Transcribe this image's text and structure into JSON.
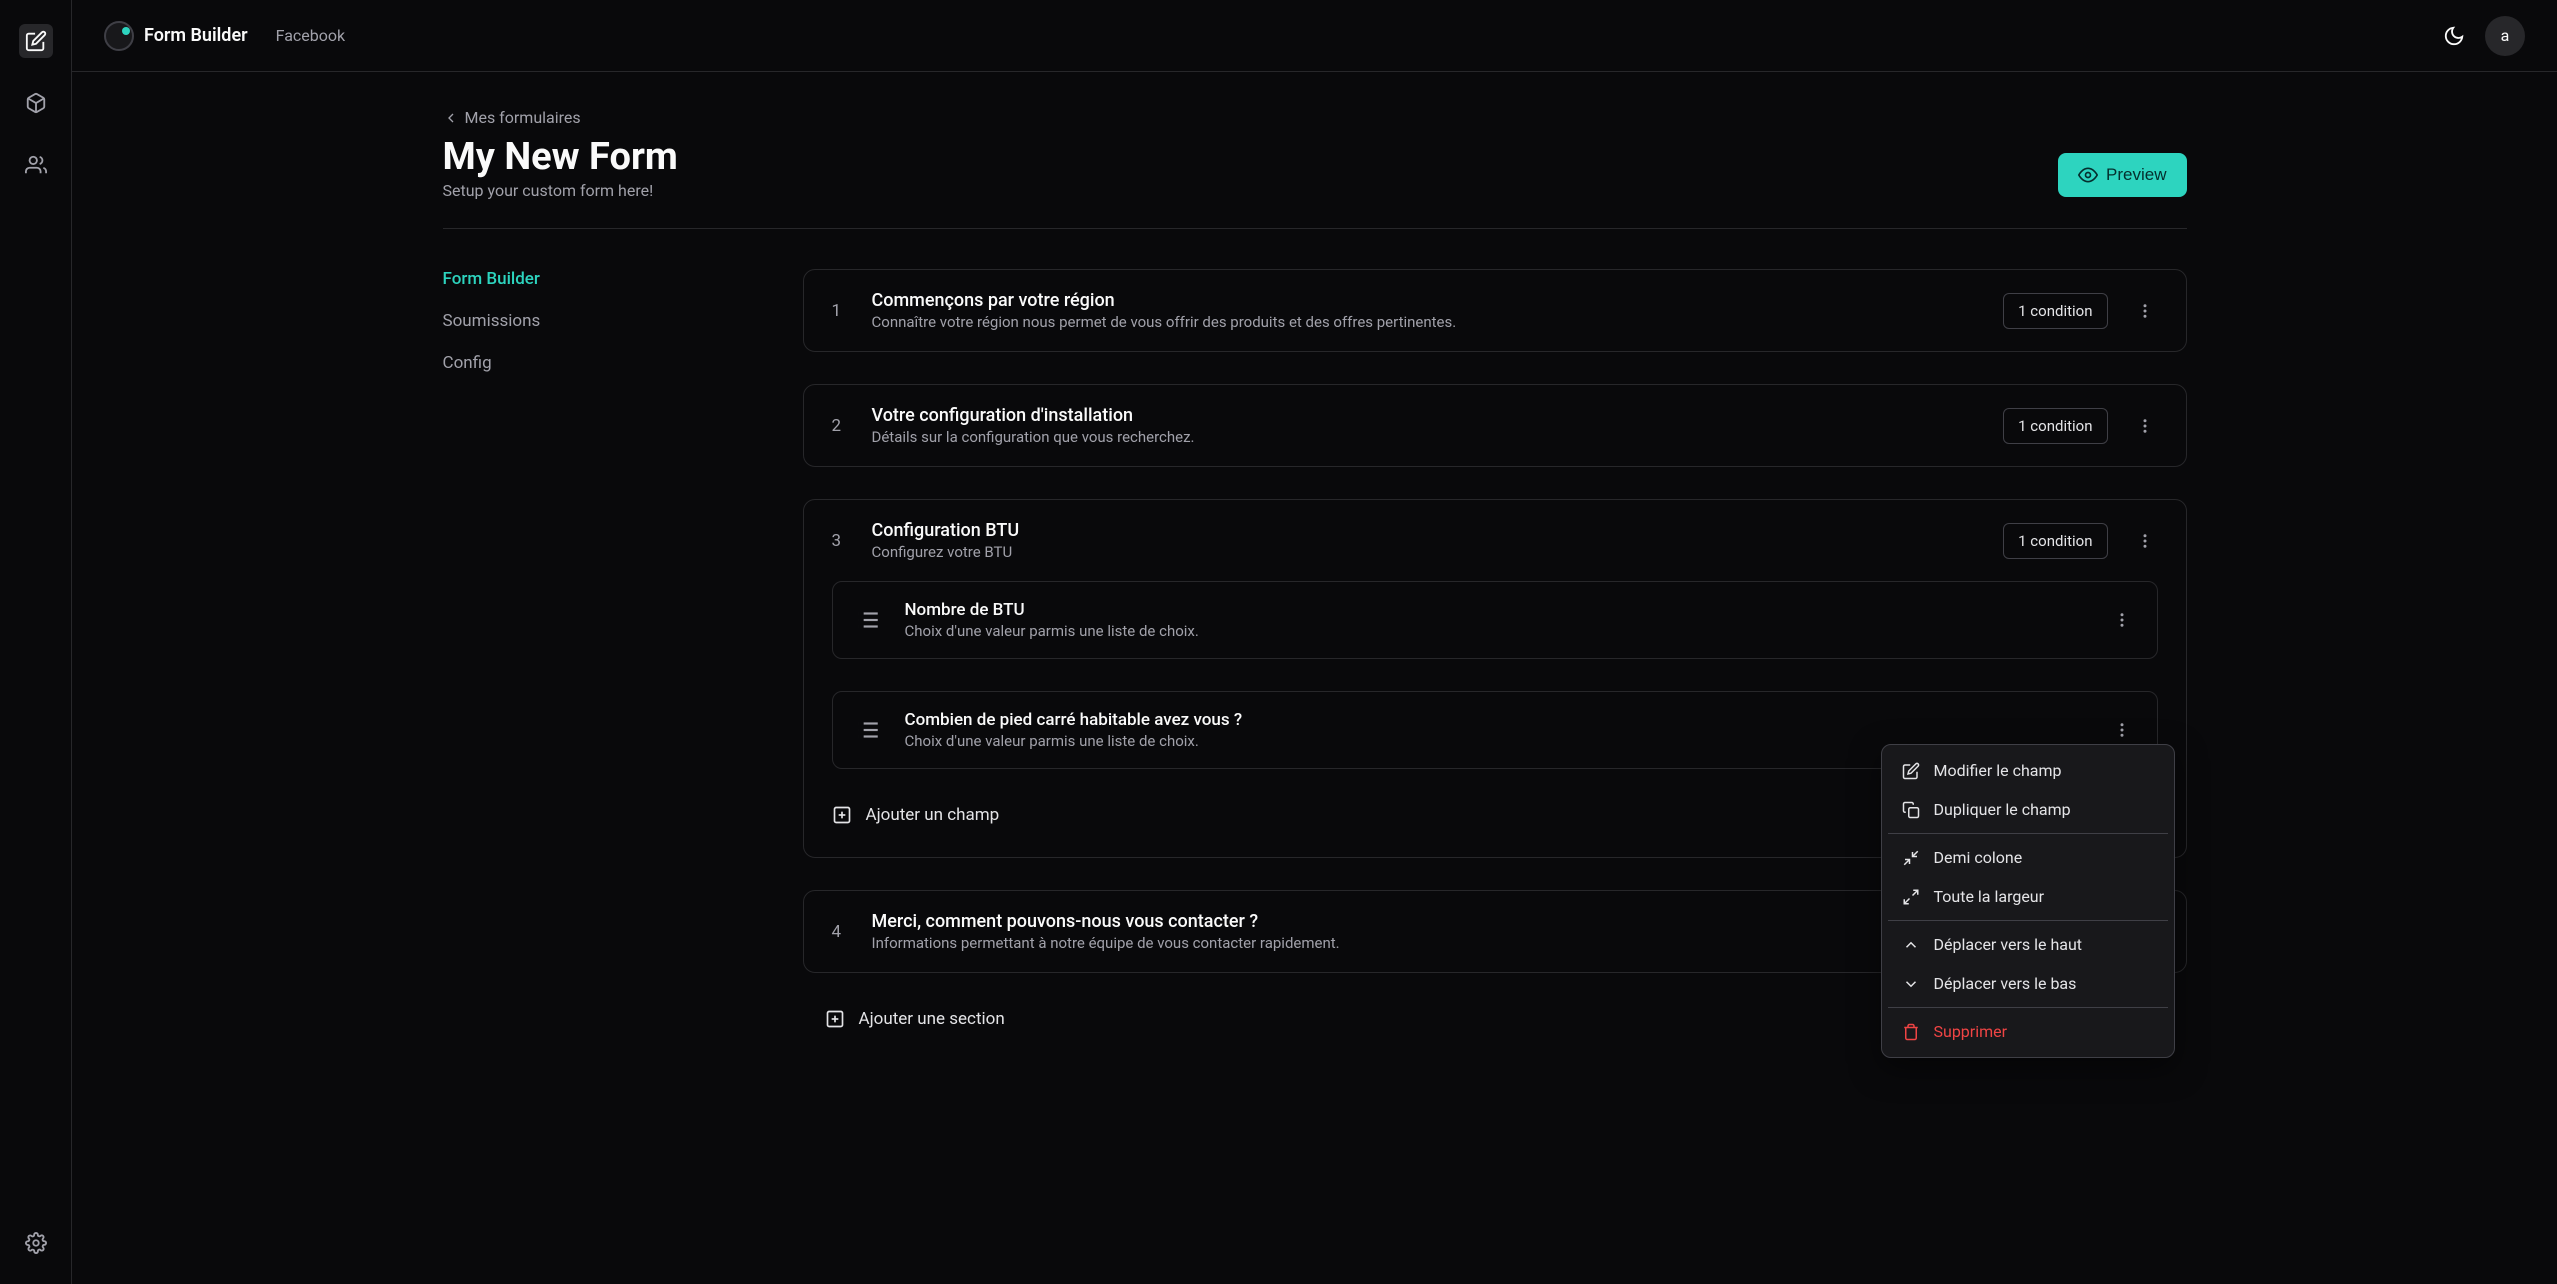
{
  "app": {
    "title": "Form Builder",
    "breadcrumb": "Facebook",
    "avatar_letter": "a"
  },
  "page": {
    "back_label": "Mes formulaires",
    "title": "My New Form",
    "subtitle": "Setup your custom form here!",
    "preview_label": "Preview"
  },
  "nav": {
    "items": [
      {
        "label": "Form Builder",
        "active": true
      },
      {
        "label": "Soumissions",
        "active": false
      },
      {
        "label": "Config",
        "active": false
      }
    ]
  },
  "sections": [
    {
      "num": "1",
      "title": "Commençons par votre région",
      "desc": "Connaître votre région nous permet de vous offrir des produits et des offres pertinentes.",
      "condition": "1 condition",
      "expanded": false
    },
    {
      "num": "2",
      "title": "Votre configuration d'installation",
      "desc": "Détails sur la configuration que vous recherchez.",
      "condition": "1 condition",
      "expanded": false
    },
    {
      "num": "3",
      "title": "Configuration BTU",
      "desc": "Configurez votre BTU",
      "condition": "1 condition",
      "expanded": true,
      "fields": [
        {
          "title": "Nombre de BTU",
          "desc": "Choix d'une valeur parmis une liste de choix."
        },
        {
          "title": "Combien de pied carré habitable avez vous ?",
          "desc": "Choix d'une valeur parmis une liste de choix."
        }
      ],
      "add_field_label": "Ajouter un champ"
    },
    {
      "num": "4",
      "title": "Merci, comment pouvons-nous vous contacter ?",
      "desc": "Informations permettant à notre équipe de vous contacter rapidement.",
      "condition": null,
      "expanded": false
    }
  ],
  "add_section_label": "Ajouter une section",
  "context_menu": {
    "edit": "Modifier le champ",
    "duplicate": "Dupliquer le champ",
    "half_col": "Demi colone",
    "full_width": "Toute la largeur",
    "move_up": "Déplacer vers le haut",
    "move_down": "Déplacer vers le bas",
    "delete": "Supprimer"
  }
}
